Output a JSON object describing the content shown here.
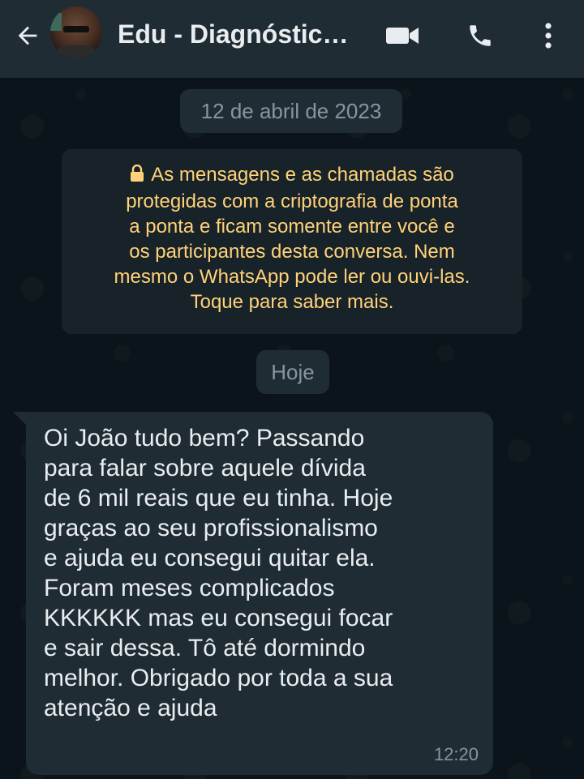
{
  "header": {
    "contact_name": "Edu - Diagnóstic…",
    "back_icon": "arrow-left-icon",
    "video_icon": "video-call-icon",
    "phone_icon": "phone-icon",
    "menu_icon": "more-vertical-icon"
  },
  "chat": {
    "date_label": "12 de abril de 2023",
    "encryption_notice": {
      "lock_icon": "lock-icon",
      "lines": [
        "As mensagens e as chamadas são",
        "protegidas com a criptografia de ponta",
        "a ponta e ficam somente entre você e",
        "os participantes desta conversa. Nem",
        "mesmo o WhatsApp pode ler ou ouvi-las.",
        "Toque para saber mais."
      ]
    },
    "today_label": "Hoje",
    "messages": [
      {
        "direction": "incoming",
        "lines": [
          "Oi João tudo bem? Passando",
          "para falar sobre aquele dívida",
          "de 6 mil reais que eu tinha. Hoje",
          "graças ao seu profissionalismo",
          "e ajuda eu consegui quitar ela.",
          "Foram meses complicados",
          "KKKKKK mas eu consegui focar",
          "e sair dessa. Tô até dormindo",
          "melhor. Obrigado por toda a sua",
          "atenção e ajuda"
        ],
        "time": "12:20"
      }
    ]
  },
  "colors": {
    "header_bg": "#1f2c34",
    "chat_bg": "#0b141a",
    "bubble_bg": "#1f2c34",
    "notice_text": "#ffd279",
    "text_primary": "#e9edef",
    "text_secondary": "#8696a0"
  }
}
